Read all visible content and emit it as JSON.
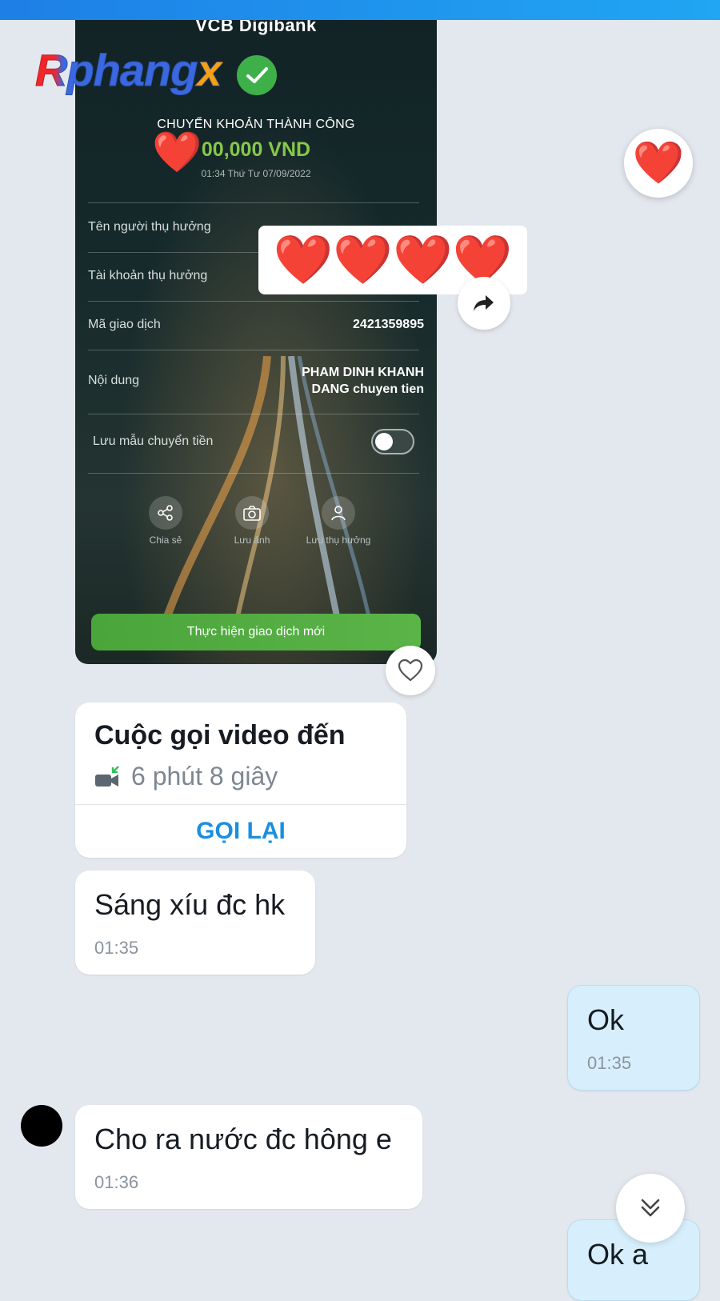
{
  "bank_screenshot": {
    "app_name": "VCB Digibank",
    "success_title": "CHUYỂN KHOẢN THÀNH CÔNG",
    "amount": "00,000 VND",
    "timestamp": "01:34 Thứ Tư 07/09/2022",
    "rows": [
      {
        "label": "Tên người thụ hưởng",
        "value": ""
      },
      {
        "label": "Tài khoản thụ hưởng",
        "value": ""
      },
      {
        "label": "Mã giao dịch",
        "value": "2421359895"
      },
      {
        "label": "Nội dung",
        "value_line1": "PHAM DINH KHANH",
        "value_line2": "DANG chuyen tien"
      }
    ],
    "save_template_label": "Lưu mẫu chuyển tiền",
    "save_template_on": false,
    "actions": [
      {
        "label": "Chia sẻ",
        "icon": "share-icon"
      },
      {
        "label": "Lưu ảnh",
        "icon": "camera-icon"
      },
      {
        "label": "Lưu thụ hưởng",
        "icon": "user-icon"
      }
    ],
    "new_transaction_label": "Thực hiện giao dịch mới"
  },
  "watermark": {
    "main": "Rphang",
    "accent": "x"
  },
  "hearts": "❤️❤️❤️❤️",
  "reaction_heart": "❤️",
  "small_heart": "❤️",
  "call_card": {
    "title": "Cuộc gọi video đến",
    "duration": "6 phút 8 giây",
    "callback_label": "GỌI LẠI"
  },
  "messages": [
    {
      "text": "Sáng xíu đc hk",
      "time": "01:35",
      "from": "other"
    },
    {
      "text": "Ok",
      "time": "01:35",
      "from": "me"
    },
    {
      "text": "Cho ra nước đc hông e",
      "time": "01:36",
      "from": "other"
    },
    {
      "text": "Ok a",
      "time": "",
      "from": "me"
    }
  ],
  "colors": {
    "topbar": "#1e7fe6",
    "chat_background": "#e3e8ee",
    "mine_bubble": "#d7effc",
    "accent_blue": "#1a8fe0",
    "bank_green": "#4aa53a",
    "heart_red": "#e0151e"
  }
}
